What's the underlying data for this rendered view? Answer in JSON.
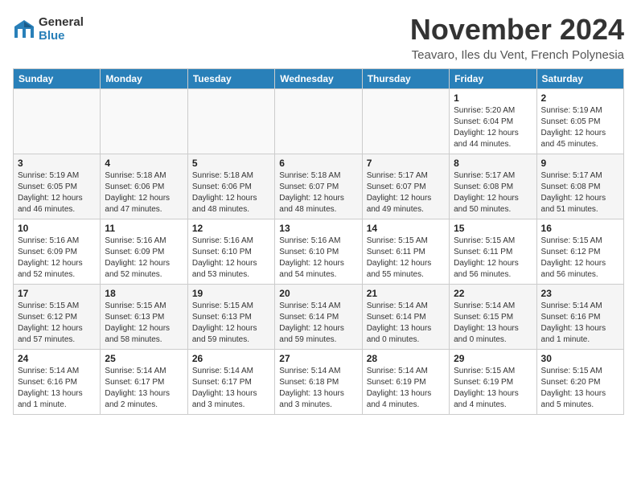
{
  "logo": {
    "general": "General",
    "blue": "Blue"
  },
  "header": {
    "month": "November 2024",
    "location": "Teavaro, Iles du Vent, French Polynesia"
  },
  "days_of_week": [
    "Sunday",
    "Monday",
    "Tuesday",
    "Wednesday",
    "Thursday",
    "Friday",
    "Saturday"
  ],
  "weeks": [
    [
      {
        "day": "",
        "info": ""
      },
      {
        "day": "",
        "info": ""
      },
      {
        "day": "",
        "info": ""
      },
      {
        "day": "",
        "info": ""
      },
      {
        "day": "",
        "info": ""
      },
      {
        "day": "1",
        "info": "Sunrise: 5:20 AM\nSunset: 6:04 PM\nDaylight: 12 hours and 44 minutes."
      },
      {
        "day": "2",
        "info": "Sunrise: 5:19 AM\nSunset: 6:05 PM\nDaylight: 12 hours and 45 minutes."
      }
    ],
    [
      {
        "day": "3",
        "info": "Sunrise: 5:19 AM\nSunset: 6:05 PM\nDaylight: 12 hours and 46 minutes."
      },
      {
        "day": "4",
        "info": "Sunrise: 5:18 AM\nSunset: 6:06 PM\nDaylight: 12 hours and 47 minutes."
      },
      {
        "day": "5",
        "info": "Sunrise: 5:18 AM\nSunset: 6:06 PM\nDaylight: 12 hours and 48 minutes."
      },
      {
        "day": "6",
        "info": "Sunrise: 5:18 AM\nSunset: 6:07 PM\nDaylight: 12 hours and 48 minutes."
      },
      {
        "day": "7",
        "info": "Sunrise: 5:17 AM\nSunset: 6:07 PM\nDaylight: 12 hours and 49 minutes."
      },
      {
        "day": "8",
        "info": "Sunrise: 5:17 AM\nSunset: 6:08 PM\nDaylight: 12 hours and 50 minutes."
      },
      {
        "day": "9",
        "info": "Sunrise: 5:17 AM\nSunset: 6:08 PM\nDaylight: 12 hours and 51 minutes."
      }
    ],
    [
      {
        "day": "10",
        "info": "Sunrise: 5:16 AM\nSunset: 6:09 PM\nDaylight: 12 hours and 52 minutes."
      },
      {
        "day": "11",
        "info": "Sunrise: 5:16 AM\nSunset: 6:09 PM\nDaylight: 12 hours and 52 minutes."
      },
      {
        "day": "12",
        "info": "Sunrise: 5:16 AM\nSunset: 6:10 PM\nDaylight: 12 hours and 53 minutes."
      },
      {
        "day": "13",
        "info": "Sunrise: 5:16 AM\nSunset: 6:10 PM\nDaylight: 12 hours and 54 minutes."
      },
      {
        "day": "14",
        "info": "Sunrise: 5:15 AM\nSunset: 6:11 PM\nDaylight: 12 hours and 55 minutes."
      },
      {
        "day": "15",
        "info": "Sunrise: 5:15 AM\nSunset: 6:11 PM\nDaylight: 12 hours and 56 minutes."
      },
      {
        "day": "16",
        "info": "Sunrise: 5:15 AM\nSunset: 6:12 PM\nDaylight: 12 hours and 56 minutes."
      }
    ],
    [
      {
        "day": "17",
        "info": "Sunrise: 5:15 AM\nSunset: 6:12 PM\nDaylight: 12 hours and 57 minutes."
      },
      {
        "day": "18",
        "info": "Sunrise: 5:15 AM\nSunset: 6:13 PM\nDaylight: 12 hours and 58 minutes."
      },
      {
        "day": "19",
        "info": "Sunrise: 5:15 AM\nSunset: 6:13 PM\nDaylight: 12 hours and 59 minutes."
      },
      {
        "day": "20",
        "info": "Sunrise: 5:14 AM\nSunset: 6:14 PM\nDaylight: 12 hours and 59 minutes."
      },
      {
        "day": "21",
        "info": "Sunrise: 5:14 AM\nSunset: 6:14 PM\nDaylight: 13 hours and 0 minutes."
      },
      {
        "day": "22",
        "info": "Sunrise: 5:14 AM\nSunset: 6:15 PM\nDaylight: 13 hours and 0 minutes."
      },
      {
        "day": "23",
        "info": "Sunrise: 5:14 AM\nSunset: 6:16 PM\nDaylight: 13 hours and 1 minute."
      }
    ],
    [
      {
        "day": "24",
        "info": "Sunrise: 5:14 AM\nSunset: 6:16 PM\nDaylight: 13 hours and 1 minute."
      },
      {
        "day": "25",
        "info": "Sunrise: 5:14 AM\nSunset: 6:17 PM\nDaylight: 13 hours and 2 minutes."
      },
      {
        "day": "26",
        "info": "Sunrise: 5:14 AM\nSunset: 6:17 PM\nDaylight: 13 hours and 3 minutes."
      },
      {
        "day": "27",
        "info": "Sunrise: 5:14 AM\nSunset: 6:18 PM\nDaylight: 13 hours and 3 minutes."
      },
      {
        "day": "28",
        "info": "Sunrise: 5:14 AM\nSunset: 6:19 PM\nDaylight: 13 hours and 4 minutes."
      },
      {
        "day": "29",
        "info": "Sunrise: 5:15 AM\nSunset: 6:19 PM\nDaylight: 13 hours and 4 minutes."
      },
      {
        "day": "30",
        "info": "Sunrise: 5:15 AM\nSunset: 6:20 PM\nDaylight: 13 hours and 5 minutes."
      }
    ]
  ]
}
